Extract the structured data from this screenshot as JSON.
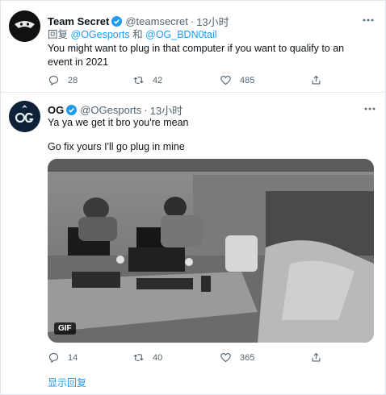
{
  "tweet1": {
    "name": "Team Secret",
    "handle": "@teamsecret",
    "time": "13小时",
    "reply_prefix": "回复",
    "reply_user1": "@OGesports",
    "reply_and": "和",
    "reply_user2": "@OG_BDN0tail",
    "text": "You might want to plug in that computer if you want to qualify to an event in 2021",
    "replies": "28",
    "retweets": "42",
    "likes": "485"
  },
  "tweet2": {
    "name": "OG",
    "handle": "@OGesports",
    "time": "13小时",
    "line1": "Ya ya we get it bro you're mean",
    "line2": "Go fix yours I'll go plug in mine",
    "gif_badge": "GIF",
    "replies": "14",
    "retweets": "40",
    "likes": "365"
  },
  "show_replies": "显示回复",
  "colors": {
    "link": "#1d9bf0",
    "verified": "#1d9bf0",
    "secondary_text": "#536471"
  },
  "icons": [
    "team-secret-avatar",
    "og-avatar",
    "verified-icon",
    "more-icon",
    "reply-icon",
    "retweet-icon",
    "like-icon",
    "share-icon"
  ]
}
